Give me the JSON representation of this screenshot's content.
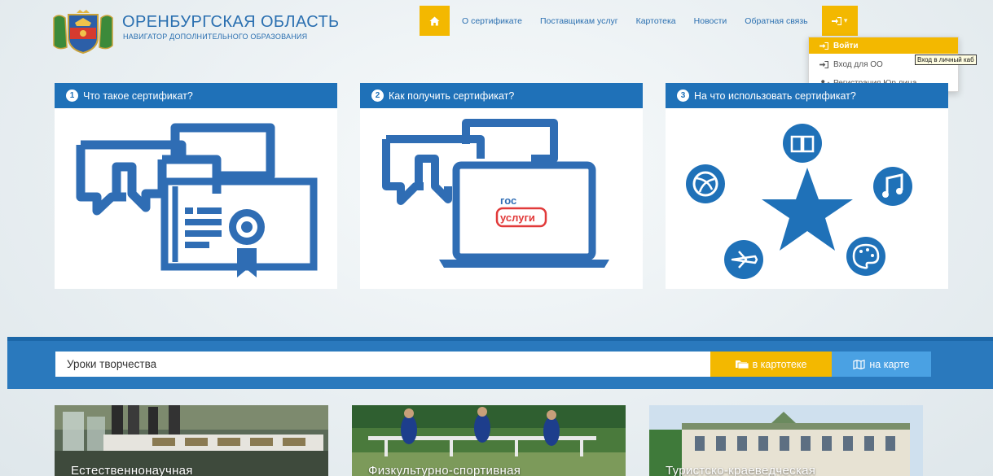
{
  "header": {
    "title": "ОРЕНБУРГСКАЯ ОБЛАСТЬ",
    "subtitle": "НАВИГАТОР ДОПОЛНИТЕЛЬНОГО ОБРАЗОВАНИЯ"
  },
  "nav": {
    "home_icon": "home-icon",
    "items": [
      "О сертификате",
      "Поставщикам услуг",
      "Картотека",
      "Новости",
      "Обратная связь"
    ],
    "login_icon": "sign-in-icon",
    "login_caret": "▾"
  },
  "dropdown": {
    "items": [
      {
        "label": "Войти",
        "icon": "sign-in-icon"
      },
      {
        "label": "Вход для ОО",
        "icon": "sign-in-icon"
      },
      {
        "label": "Регистрация Юр.лица",
        "icon": "user-plus-icon"
      }
    ],
    "tooltip": "Вход в личный каб"
  },
  "cards": [
    {
      "num": "1",
      "title": "Что такое сертификат?"
    },
    {
      "num": "2",
      "title": "Как получить сертификат?",
      "gos_line1": "гос",
      "gos_line2": "услуги"
    },
    {
      "num": "3",
      "title": "На что использовать сертификат?"
    }
  ],
  "search": {
    "value": "Уроки творчества",
    "catalog_btn": "в картотеке",
    "map_btn": "на карте"
  },
  "tiles": [
    {
      "label": "Естественнонаучная"
    },
    {
      "label": "Физкультурно-спортивная"
    },
    {
      "label": "Туристско-краеведческая"
    }
  ],
  "colors": {
    "brand_blue": "#1f71b8",
    "accent_yellow": "#f3b800",
    "map_blue": "#4aa1e3"
  }
}
